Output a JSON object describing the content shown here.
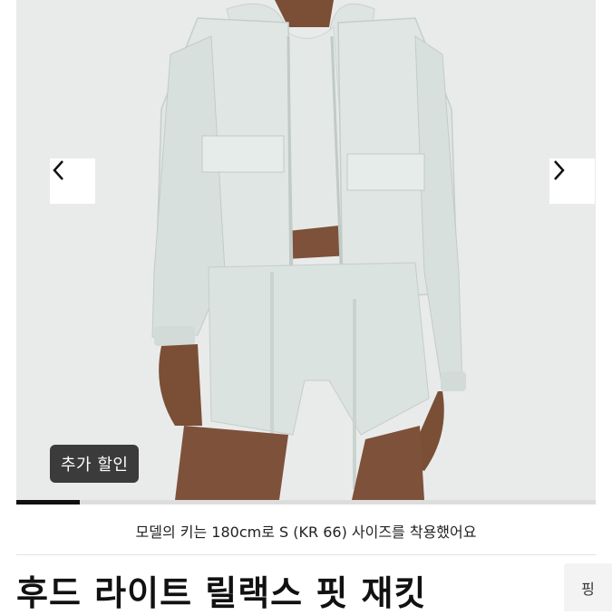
{
  "gallery": {
    "prev_icon": "chevron-left-icon",
    "next_icon": "chevron-right-icon",
    "badge_label": "추가 할인",
    "progress_fraction": 0.11,
    "background_color": "#e9ebeb",
    "jacket_color": "#dfe6e3"
  },
  "caption": "모델의 키는 180cm로 S (KR 66) 사이즈를 착용했어요",
  "product": {
    "title": "후드 라이트 릴랙스 핏 재킷"
  },
  "side_button": {
    "label": "핑"
  }
}
